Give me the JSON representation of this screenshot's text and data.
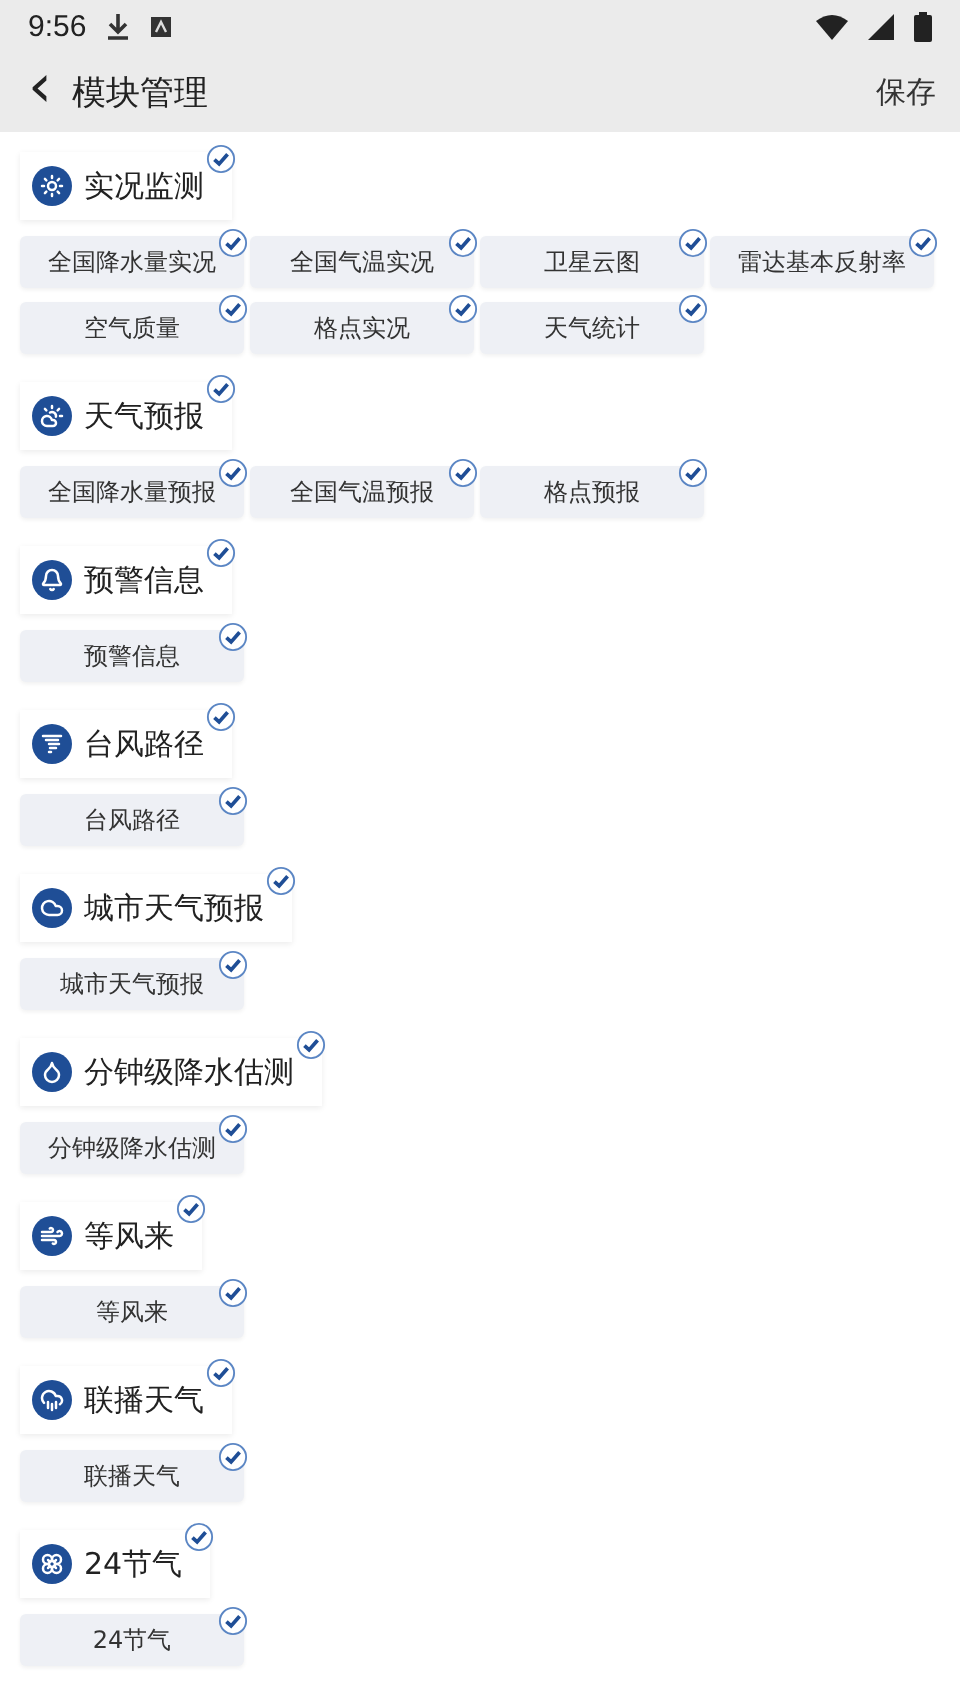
{
  "status_bar": {
    "time": "9:56"
  },
  "app_bar": {
    "back": "‹",
    "title": "模块管理",
    "action": "保存"
  },
  "sections": [
    {
      "title": "实况监测",
      "checked": true,
      "items": [
        {
          "label": "全国降水量实况",
          "checked": true
        },
        {
          "label": "全国气温实况",
          "checked": true
        },
        {
          "label": "卫星云图",
          "checked": true
        },
        {
          "label": "雷达基本反射率",
          "checked": true
        },
        {
          "label": "空气质量",
          "checked": true
        },
        {
          "label": "格点实况",
          "checked": true
        },
        {
          "label": "天气统计",
          "checked": true
        }
      ]
    },
    {
      "title": "天气预报",
      "checked": true,
      "items": [
        {
          "label": "全国降水量预报",
          "checked": true
        },
        {
          "label": "全国气温预报",
          "checked": true
        },
        {
          "label": "格点预报",
          "checked": true
        }
      ]
    },
    {
      "title": "预警信息",
      "checked": true,
      "items": [
        {
          "label": "预警信息",
          "checked": true
        }
      ]
    },
    {
      "title": "台风路径",
      "checked": true,
      "items": [
        {
          "label": "台风路径",
          "checked": true
        }
      ]
    },
    {
      "title": "城市天气预报",
      "checked": true,
      "items": [
        {
          "label": "城市天气预报",
          "checked": true
        }
      ]
    },
    {
      "title": "分钟级降水估测",
      "checked": true,
      "items": [
        {
          "label": "分钟级降水估测",
          "checked": true
        }
      ]
    },
    {
      "title": "等风来",
      "checked": true,
      "items": [
        {
          "label": "等风来",
          "checked": true
        }
      ]
    },
    {
      "title": "联播天气",
      "checked": true,
      "items": [
        {
          "label": "联播天气",
          "checked": true
        }
      ]
    },
    {
      "title": "24节气",
      "checked": true,
      "items": [
        {
          "label": "24节气",
          "checked": true
        }
      ]
    }
  ]
}
